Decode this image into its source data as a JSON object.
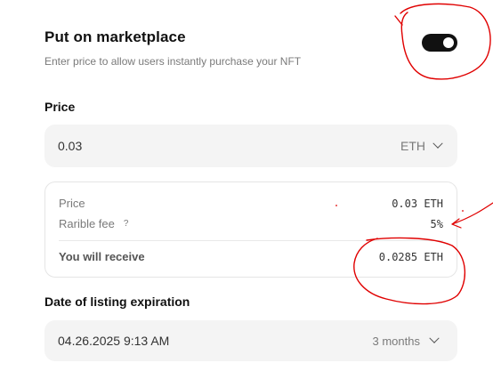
{
  "marketplace": {
    "title": "Put on marketplace",
    "subtitle": "Enter price to allow users instantly purchase your NFT",
    "toggle_on": true
  },
  "price": {
    "label": "Price",
    "value": "0.03",
    "currency": "ETH"
  },
  "summary": {
    "price_label": "Price",
    "price_value": "0.03 ETH",
    "fee_label": "Rarible fee",
    "fee_help": "?",
    "fee_value": "5%",
    "receive_label": "You will receive",
    "receive_value": "0.0285 ETH"
  },
  "expiration": {
    "label": "Date of listing expiration",
    "date_value": "04.26.2025 9:13 AM",
    "duration": "3 months"
  },
  "annotation_color": "#e00000"
}
